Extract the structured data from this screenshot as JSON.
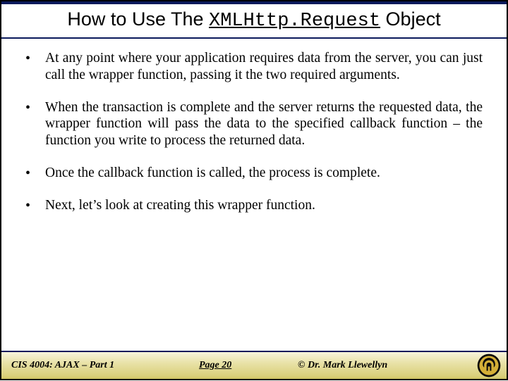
{
  "title": {
    "prefix": "How to Use The ",
    "mono": "XMLHttp.Request",
    "suffix": " Object"
  },
  "bullets": [
    "At any point where your application requires data from the server, you can just call the wrapper function, passing it the two required arguments.",
    "When the transaction is complete and the server returns the requested data, the wrapper function will pass the data to the specified callback function – the function you write to process the returned data.",
    "Once the callback function is called, the process is complete.",
    "Next, let’s look at creating this wrapper function."
  ],
  "footer": {
    "course": "CIS 4004: AJAX – Part 1",
    "page": "Page 20",
    "copyright": "© Dr. Mark Llewellyn"
  }
}
